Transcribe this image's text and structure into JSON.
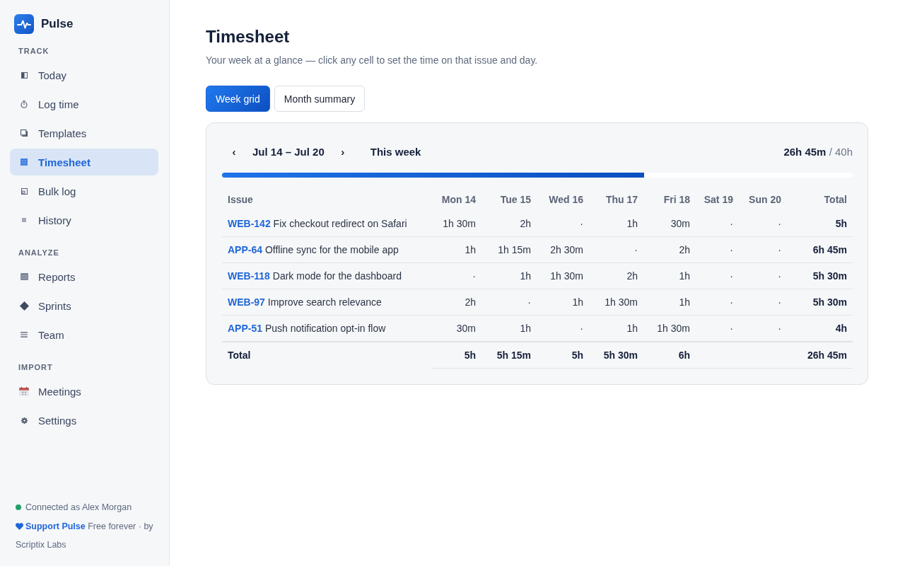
{
  "sidebar": {
    "app_name": "Pulse",
    "sections": [
      {
        "label": "TRACK",
        "items": [
          {
            "label": "Today",
            "selected": false
          },
          {
            "label": "Log time",
            "selected": false
          },
          {
            "label": "Templates",
            "selected": false
          },
          {
            "label": "Timesheet",
            "selected": true
          },
          {
            "label": "Bulk log",
            "selected": false
          },
          {
            "label": "History",
            "selected": false
          }
        ]
      },
      {
        "label": "ANALYZE",
        "items": [
          {
            "label": "Reports",
            "selected": false
          },
          {
            "label": "Sprints",
            "selected": false
          },
          {
            "label": "Team",
            "selected": false
          }
        ]
      },
      {
        "label": "IMPORT",
        "items": [
          {
            "label": "Meetings",
            "selected": false
          },
          {
            "label": "Settings",
            "selected": false
          }
        ]
      }
    ],
    "status": {
      "text": "Connected as Alex Morgan",
      "connected": true
    },
    "footer": {
      "link": "Support Pulse",
      "text": "Free forever · by Scriptix Labs"
    }
  },
  "page": {
    "title": "Timesheet",
    "subtitle": "Your week at a glance — click any cell to set the time on that issue and day."
  },
  "view_tabs": [
    {
      "label": "Week grid",
      "selected": true
    },
    {
      "label": "Month summary",
      "selected": false
    }
  ],
  "week": {
    "prev": "‹",
    "range": "Jul 14 – Jul 20",
    "next": "›",
    "current": "This week",
    "summary": "**26h 45m** / 40h",
    "level": 0.669
  },
  "table": {
    "columns": [
      "Issue",
      "Mon 14",
      "Tue 15",
      "Wed 16",
      "Thu 17",
      "Fri 18",
      "Sat 19",
      "Sun 20",
      "Total"
    ],
    "rows": [
      {
        "cells": [
          "**WEB-142** Fix checkout redirect on Safari",
          "1h 30m",
          "2h",
          "·",
          "1h",
          "30m",
          "·",
          "·",
          "5h"
        ]
      },
      {
        "cells": [
          "**APP-64** Offline sync for the mobile app",
          "1h",
          "1h 15m",
          "2h 30m",
          "·",
          "2h",
          "·",
          "·",
          "6h 45m"
        ]
      },
      {
        "cells": [
          "**WEB-118** Dark mode for the dashboard",
          "·",
          "1h",
          "1h 30m",
          "2h",
          "1h",
          "·",
          "·",
          "5h 30m"
        ]
      },
      {
        "cells": [
          "**WEB-97** Improve search relevance",
          "2h",
          "·",
          "1h",
          "1h 30m",
          "1h",
          "·",
          "·",
          "5h 30m"
        ]
      },
      {
        "cells": [
          "**APP-51** Push notification opt-in flow",
          "30m",
          "1h",
          "·",
          "1h",
          "1h 30m",
          "·",
          "·",
          "4h"
        ]
      }
    ],
    "totals": {
      "cells": [
        "Total",
        "5h",
        "5h 15m",
        "5h",
        "5h 30m",
        "6h",
        "",
        "",
        "26h 45m"
      ]
    }
  }
}
